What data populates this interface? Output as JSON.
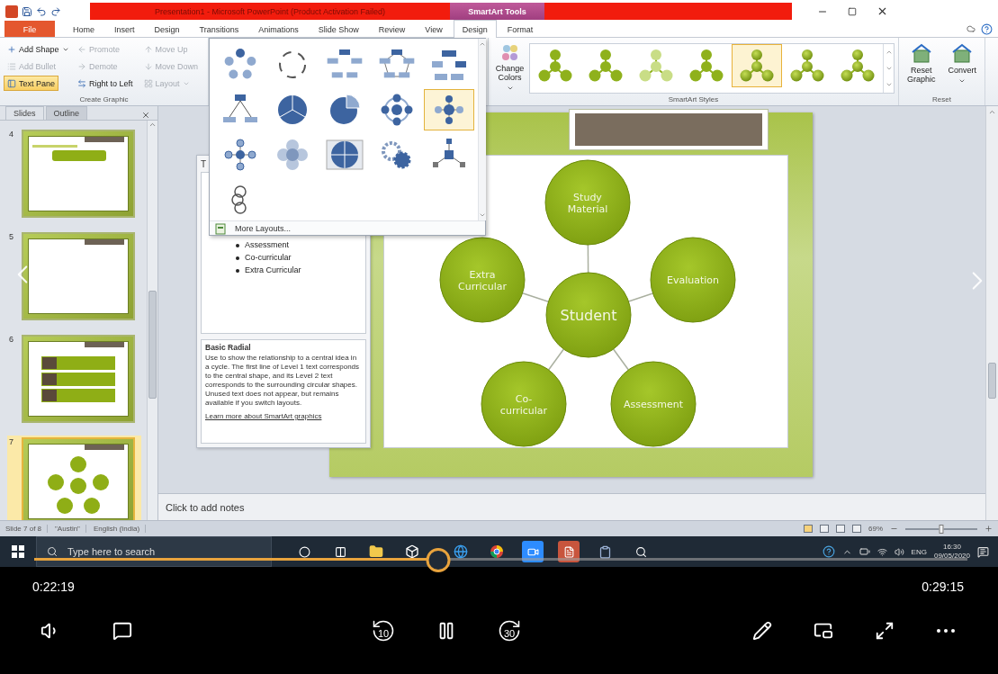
{
  "title_bar": {
    "title": "Presentation1 - Microsoft PowerPoint (Product Activation Failed)",
    "tool_group": "SmartArt Tools"
  },
  "ribbon_tabs": [
    {
      "label": "File",
      "kind": "file",
      "selected": false
    },
    {
      "label": "Home",
      "kind": "plain",
      "selected": false
    },
    {
      "label": "Insert",
      "kind": "plain",
      "selected": false
    },
    {
      "label": "Design",
      "kind": "plain",
      "selected": false
    },
    {
      "label": "Transitions",
      "kind": "plain",
      "selected": false
    },
    {
      "label": "Animations",
      "kind": "plain",
      "selected": false
    },
    {
      "label": "Slide Show",
      "kind": "plain",
      "selected": false
    },
    {
      "label": "Review",
      "kind": "plain",
      "selected": false
    },
    {
      "label": "View",
      "kind": "plain",
      "selected": false
    },
    {
      "label": "Design",
      "kind": "context",
      "selected": true
    },
    {
      "label": "Format",
      "kind": "context",
      "selected": false
    }
  ],
  "create_graphic": {
    "label": "Create Graphic",
    "buttons": [
      {
        "label": "Add Shape",
        "disabled": false,
        "selected": false,
        "dropdown": true
      },
      {
        "label": "Add Bullet",
        "disabled": true,
        "selected": false,
        "dropdown": false
      },
      {
        "label": "Text Pane",
        "disabled": false,
        "selected": true,
        "dropdown": false
      },
      {
        "label": "Promote",
        "disabled": true,
        "selected": false,
        "dropdown": false
      },
      {
        "label": "Demote",
        "disabled": true,
        "selected": false,
        "dropdown": false
      },
      {
        "label": "Right to Left",
        "disabled": false,
        "selected": false,
        "dropdown": false
      },
      {
        "label": "Move Up",
        "disabled": true,
        "selected": false,
        "dropdown": false
      },
      {
        "label": "Move Down",
        "disabled": true,
        "selected": false,
        "dropdown": false
      },
      {
        "label": "Layout",
        "disabled": true,
        "selected": false,
        "dropdown": true
      }
    ]
  },
  "change_colors": {
    "label": "Change Colors",
    "dropdown": true
  },
  "smartart_styles": {
    "label": "SmartArt Styles",
    "items": [
      {
        "kind": "flat",
        "selected": false
      },
      {
        "kind": "flat",
        "selected": false
      },
      {
        "kind": "light",
        "selected": false
      },
      {
        "kind": "flat",
        "selected": false
      },
      {
        "kind": "gloss",
        "selected": true
      },
      {
        "kind": "gloss",
        "selected": false
      },
      {
        "kind": "gloss",
        "selected": false
      }
    ]
  },
  "reset": {
    "label": "Reset",
    "buttons": [
      {
        "label": "Reset Graphic",
        "dropdown": false
      },
      {
        "label": "Convert",
        "dropdown": true
      }
    ]
  },
  "layouts_gallery": {
    "items": [
      {
        "kind": "cycle",
        "selected": false
      },
      {
        "kind": "dashed_cycle",
        "selected": false
      },
      {
        "kind": "box_cycle",
        "selected": false
      },
      {
        "kind": "box_pentagon",
        "selected": false
      },
      {
        "kind": "box_ring",
        "selected": false
      },
      {
        "kind": "split",
        "selected": false
      },
      {
        "kind": "pie",
        "selected": false
      },
      {
        "kind": "pie_cut",
        "selected": false
      },
      {
        "kind": "radial_cycle",
        "selected": false
      },
      {
        "kind": "radial",
        "selected": true
      },
      {
        "kind": "cross",
        "selected": false
      },
      {
        "kind": "soft_cross",
        "selected": false
      },
      {
        "kind": "quad",
        "selected": false
      },
      {
        "kind": "gears",
        "selected": false
      },
      {
        "kind": "hub",
        "selected": false
      },
      {
        "kind": "spiral",
        "selected": false
      }
    ],
    "more_layouts": "More Layouts..."
  },
  "slides_panel": {
    "tabs": [
      {
        "label": "Slides",
        "selected": true
      },
      {
        "label": "Outline",
        "selected": false
      }
    ],
    "thumbnails": [
      {
        "number": "4",
        "kind": "title_box",
        "selected": false
      },
      {
        "number": "5",
        "kind": "blank",
        "selected": false
      },
      {
        "number": "6",
        "kind": "list",
        "selected": false
      },
      {
        "number": "7",
        "kind": "radial",
        "selected": true
      }
    ]
  },
  "text_pane": {
    "title": "T",
    "bullets": [
      "Assessment",
      "Co-curricular",
      "Extra Curricular"
    ],
    "description": {
      "title": "Basic Radial",
      "text": "Use to show the relationship to a central idea in a cycle. The first line of Level 1 text corresponds to the central shape, and its Level 2 text corresponds to the surrounding circular shapes. Unused text does not appear, but remains available if you switch layouts.",
      "link": "Learn more about SmartArt graphics"
    }
  },
  "slide": {
    "diagram": {
      "center": "Student",
      "nodes": [
        "Study Material",
        "Evaluation",
        "Assessment",
        "Co-curricular",
        "Extra Curricular"
      ]
    }
  },
  "notes": {
    "placeholder": "Click to add notes"
  },
  "status_bar": {
    "items": [
      "Slide 7 of 8",
      "\"Austin\"",
      "English (India)"
    ],
    "zoom": "69%",
    "zoom_slider": {
      "level": 0.5
    }
  },
  "taskbar": {
    "search": {
      "placeholder": "Type here to search"
    },
    "language": "ENG",
    "time": "16:30",
    "date": "09/05/2020"
  },
  "player": {
    "elapsed": "0:22:19",
    "duration": "0:29:15",
    "level": 0.433,
    "playing": true,
    "skip_back": "10",
    "skip_forward": "30"
  }
}
